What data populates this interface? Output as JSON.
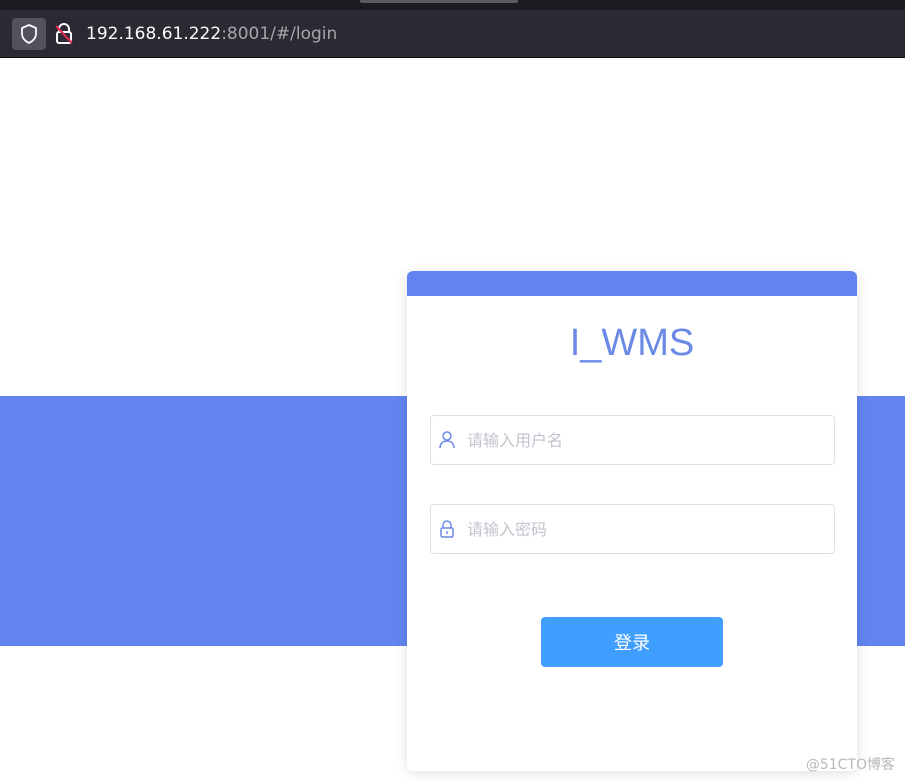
{
  "browser": {
    "url_host": "192.168.61.222",
    "url_rest": ":8001/#/login",
    "icons": [
      "shield-icon",
      "insecure-lock-icon"
    ]
  },
  "login": {
    "title": "I_WMS",
    "username_placeholder": "请输入用户名",
    "password_placeholder": "请输入密码",
    "submit_label": "登录",
    "icons": [
      "user-icon",
      "lock-icon"
    ]
  },
  "watermark": "@51CTO博客",
  "colors": {
    "band": "#6184f0",
    "title": "#6b8ae6",
    "button": "#409eff",
    "chrome": "#2b2a33"
  }
}
